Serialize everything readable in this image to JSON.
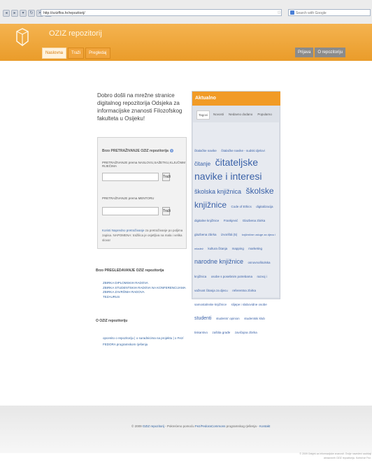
{
  "browser": {
    "url": "http://ozizffos.hr/repozitorij/",
    "search_placeholder": "Search with Google"
  },
  "header": {
    "title": "OZIZ repozitorij",
    "tabs": [
      "Naslovna",
      "Traži",
      "Pregledaj"
    ],
    "right_links": [
      "Prijava",
      "O repozitoriju"
    ]
  },
  "intro": "Dobro došli na mrežne stranice digitalnog repozitorija Odsjeka za informacijske znanosti Filozofskog fakulteta u Osijeku!",
  "search": {
    "title": "Brzo PRETRAŽIVANJE OZIZ repozitorija",
    "help": "?",
    "label1": "PRETRAŽIVANJE prema NASLOVU,SAŽETKU,KLJUČNIM RIJEČIMA",
    "button1": "Traži",
    "label2": "PRETRAŽIVANJE prema MENTORU",
    "button2": "Traži",
    "note_link": "Koristi Napredno pretraživanje",
    "note_text": " za pretraživanje po poljima zapisa. NAPOMENA: tražilica je osjetljiva na mala i velika slova!"
  },
  "browse": {
    "heading": "Brzo PREGLEDAVANJE OZIZ repozitorija",
    "items": [
      "ZBIRKA DIPLOMSKIH RADOVA",
      "ZBIRKA STUDENTSKIH RADOVA NA KONFERENCIJAMA",
      "ZBIRKA ZAVRŠNIH RADOVA",
      "TEZAURUS"
    ]
  },
  "about": {
    "heading": "O OZIZ repozitoriju",
    "text": "opcenito o repozitoriju | o suradnicima na projektu | o Fez/ FEDORA programskom rješenju"
  },
  "aktualno": {
    "title": "Aktualno",
    "tabs": [
      "Tagovi",
      "Novosti",
      "Nedavno dodano",
      "Popularno"
    ]
  },
  "tag_cloud": [
    {
      "t": "čitalačke navike",
      "s": 4.5
    },
    {
      "t": "čitalačke navike - sudski djelovi",
      "s": 4.5
    },
    {
      "t": "čitanje",
      "s": 8
    },
    {
      "t": "čitateljske navike i interesi",
      "s": 14
    },
    {
      "t": "školska knjižnica",
      "s": 9
    },
    {
      "t": "školske knjižnice",
      "s": 12
    },
    {
      "t": "Code of Ethics",
      "s": 4.5
    },
    {
      "t": "digitalizacija",
      "s": 4.5
    },
    {
      "t": "digitalne knjižnice",
      "s": 4.5
    },
    {
      "t": "Frankjević",
      "s": 4.5
    },
    {
      "t": "Glazbena zbirka",
      "s": 4.5
    },
    {
      "t": "glazbena zbirka",
      "s": 4.5
    },
    {
      "t": "izvorištá (5)",
      "s": 4.5
    },
    {
      "t": "knjižnične usluge za djecu i mladež",
      "s": 4
    },
    {
      "t": "kultura čitanja",
      "s": 4.5
    },
    {
      "t": "mapping",
      "s": 4.5
    },
    {
      "t": "marketing",
      "s": 4.5
    },
    {
      "t": "narodne knjižnice",
      "s": 9
    },
    {
      "t": "osnovnoškolska knjižnica",
      "s": 4.5
    },
    {
      "t": "osobe s posebnim potrebama",
      "s": 4.5
    },
    {
      "t": "razvoj i važnost čitanja za djecu",
      "s": 4.5
    },
    {
      "t": "referentna zbirka",
      "s": 4.5
    },
    {
      "t": "samostalnske knjižnice",
      "s": 4.5
    },
    {
      "t": "slijepe i slabovidne osobe",
      "s": 4.5
    },
    {
      "t": "studenti",
      "s": 7
    },
    {
      "t": "students' opinion",
      "s": 4.5
    },
    {
      "t": "studentski klub",
      "s": 4.5
    },
    {
      "t": "tiskarstvo",
      "s": 4.5
    },
    {
      "t": "zaštita građe",
      "s": 4.5
    },
    {
      "t": "zavičajna zbirka",
      "s": 4.5
    }
  ],
  "footer": {
    "year": "© 2009",
    "repo_link": "OZIZ repozitorij",
    "mid1": " - Pokrećeno pomoću ",
    "fez_link": "Fez/FedoraCommons",
    "mid2": " programskog rješenja - ",
    "contact": "Kontakt",
    "copyright": "© 2009 Odsjek za informacijske znanosti. Ovdje navedeni sadržaji obrazovnih OZIZ repozitorija. Koristi se Fez."
  },
  "colors": {
    "accent": "#f19b26",
    "link": "#2c5f9f"
  }
}
